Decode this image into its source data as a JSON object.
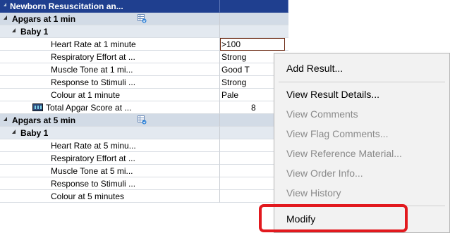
{
  "grid": {
    "header": {
      "title": "Newborn Resuscitation an...",
      "value": ""
    },
    "groups": [
      {
        "label": "Apgars at 1 min",
        "baby": "Baby 1",
        "items": [
          {
            "label": "Heart Rate at 1 minute",
            "value": ">100"
          },
          {
            "label": "Respiratory Effort at ...",
            "value": "Strong"
          },
          {
            "label": "Muscle Tone at 1 mi...",
            "value": "Good T"
          },
          {
            "label": "Response to Stimuli ...",
            "value": "Strong"
          },
          {
            "label": "Colour at 1 minute",
            "value": "Pale"
          }
        ],
        "total": {
          "label": "Total Apgar Score at ...",
          "value": "8"
        }
      },
      {
        "label": "Apgars at 5 min",
        "baby": "Baby 1",
        "items": [
          {
            "label": "Heart Rate at 5 minu...",
            "value": ""
          },
          {
            "label": "Respiratory Effort at ...",
            "value": ""
          },
          {
            "label": "Muscle Tone at 5 mi...",
            "value": ""
          },
          {
            "label": "Response to Stimuli ...",
            "value": ""
          },
          {
            "label": "Colour at 5 minutes",
            "value": ""
          }
        ]
      }
    ]
  },
  "context_menu": {
    "items": [
      {
        "label": "Add Result...",
        "enabled": true
      },
      {
        "label": "View Result Details...",
        "enabled": true
      },
      {
        "label": "View Comments",
        "enabled": false
      },
      {
        "label": "View Flag Comments...",
        "enabled": false
      },
      {
        "label": "View Reference Material...",
        "enabled": false
      },
      {
        "label": "View Order Info...",
        "enabled": false
      },
      {
        "label": "View History",
        "enabled": false
      },
      {
        "label": "Modify",
        "enabled": true
      }
    ]
  },
  "colors": {
    "header_bg": "#1f3f8f",
    "group_bg": "#d2dbe6",
    "highlight_border": "#e2191e",
    "disabled_text": "#8a8a8a"
  }
}
